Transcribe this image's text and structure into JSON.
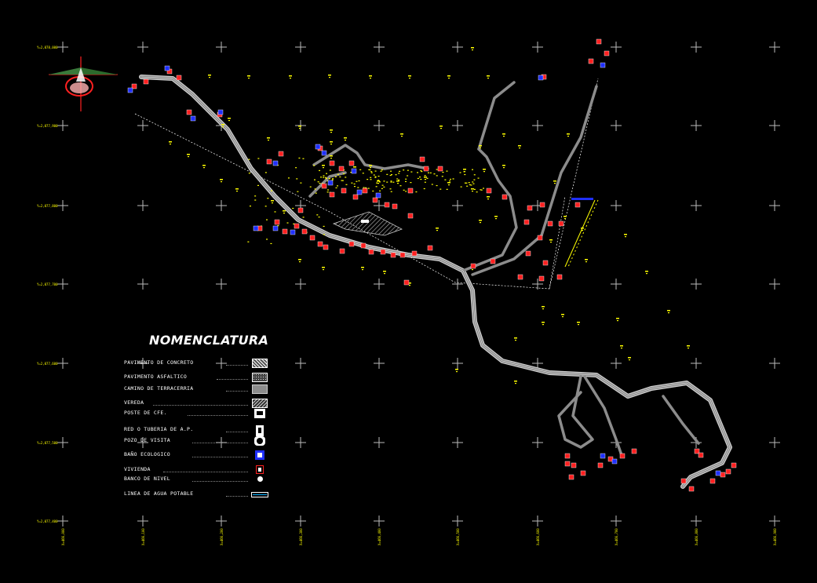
{
  "legend": {
    "title": "NOMENCLATURA",
    "items": [
      {
        "label": "PAVIMENTO DE CONCRETO",
        "symbol": "hatch-concrete"
      },
      {
        "label": "PAVIMENTO ASFALTICO",
        "symbol": "dotted-asphalt"
      },
      {
        "label": "CAMINO DE TERRACERRIA",
        "symbol": "gray-fill"
      },
      {
        "label": "VEREDA",
        "symbol": "hatch-vereda"
      },
      {
        "label": "POSTE DE CFE.",
        "symbol": "pole-icon"
      },
      {
        "label": "RED O TUBERIA DE A.P.",
        "symbol": "pipe-icon"
      },
      {
        "label": "POZO DE VISITA",
        "symbol": "manhole-icon"
      },
      {
        "label": "BAÑO ECOLOGICO",
        "symbol": "bathroom-icon"
      },
      {
        "label": "VIVIENDA",
        "symbol": "house-icon"
      },
      {
        "label": "BANCO DE NIVEL",
        "symbol": "benchmark-icon"
      },
      {
        "label": "LINEA DE AGUA POTABLE",
        "symbol": "water-line-icon"
      }
    ]
  },
  "grid": {
    "y_labels": [
      "Y=2,078,000",
      "Y=2,077,900",
      "Y=2,077,800",
      "Y=2,077,700",
      "Y=2,077,600",
      "Y=2,077,500",
      "Y=2,077,400"
    ],
    "x_labels": [
      "X=466,000",
      "X=466,100",
      "X=466,200",
      "X=466,300",
      "X=466,400",
      "X=466,500",
      "X=466,600",
      "X=466,700",
      "X=466,800",
      "X=466,900"
    ]
  },
  "colors": {
    "background": "#000000",
    "road": "#8c8c8c",
    "road_edge": "#cfcfcf",
    "annotation": "#ffff00",
    "house": "#ff2020",
    "bathroom": "#2030ff",
    "grid_cross": "#bbbbbb",
    "north_arrow": "#ff2020"
  }
}
